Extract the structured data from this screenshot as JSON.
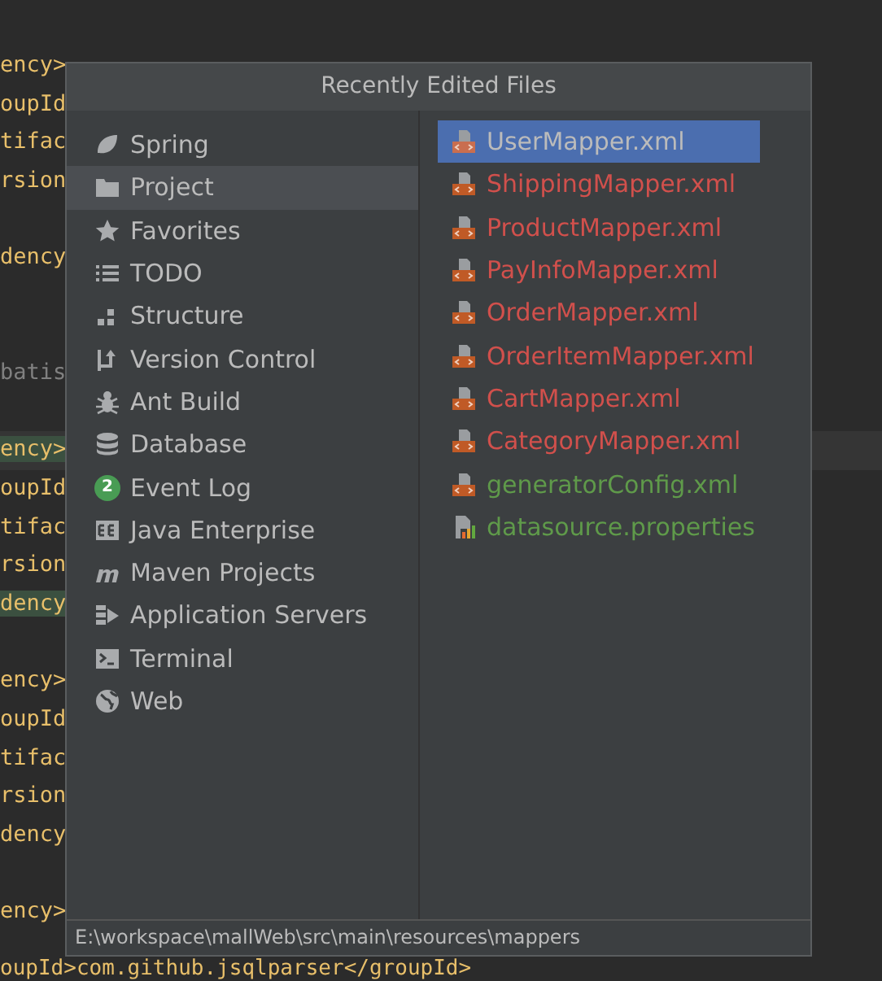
{
  "editor": {
    "lines": [
      {
        "text": "ency>",
        "kind": "tag",
        "highlight": false,
        "caret": false
      },
      {
        "text": "oupId",
        "kind": "tag",
        "highlight": false,
        "caret": false
      },
      {
        "text": "tifac",
        "kind": "tag",
        "highlight": false,
        "caret": false
      },
      {
        "text": "rsion",
        "kind": "tag",
        "highlight": false,
        "caret": false
      },
      {
        "kind": "blank"
      },
      {
        "text": "dency",
        "kind": "tag",
        "highlight": false,
        "caret": false
      },
      {
        "kind": "blank"
      },
      {
        "kind": "blank"
      },
      {
        "text": "batis",
        "kind": "comment",
        "highlight": false,
        "caret": false
      },
      {
        "kind": "blank"
      },
      {
        "text": "ency>",
        "kind": "tag",
        "highlight": true,
        "caret": true
      },
      {
        "text": "oupId",
        "kind": "tag",
        "highlight": false,
        "caret": false
      },
      {
        "text": "tifac",
        "kind": "tag",
        "highlight": false,
        "caret": false
      },
      {
        "text": "rsion",
        "kind": "tag",
        "highlight": false,
        "caret": false
      },
      {
        "text": "dency",
        "kind": "tag",
        "highlight": true,
        "caret": false
      },
      {
        "kind": "blank"
      },
      {
        "text": "ency>",
        "kind": "tag",
        "highlight": false,
        "caret": false
      },
      {
        "text": "oupId",
        "kind": "tag",
        "highlight": false,
        "caret": false
      },
      {
        "text": "tifac",
        "kind": "tag",
        "highlight": false,
        "caret": false
      },
      {
        "text": "rsion",
        "kind": "tag",
        "highlight": false,
        "caret": false
      },
      {
        "text": "dency",
        "kind": "tag",
        "highlight": false,
        "caret": false
      },
      {
        "kind": "blank"
      },
      {
        "text": "ency>",
        "kind": "tag",
        "highlight": false,
        "caret": false
      },
      {
        "text": "oupId>com.github.jsqlparser</groupId>",
        "kind": "tag",
        "highlight": false,
        "caret": false
      }
    ]
  },
  "popup": {
    "title": "Recently Edited Files",
    "tool_windows": [
      {
        "label": "Spring",
        "kind": "spring",
        "selected": false
      },
      {
        "label": "Project",
        "kind": "project",
        "selected": true
      },
      {
        "label": "Favorites",
        "kind": "favorites",
        "selected": false
      },
      {
        "label": "TODO",
        "kind": "todo",
        "selected": false
      },
      {
        "label": "Structure",
        "kind": "structure",
        "selected": false
      },
      {
        "label": "Version Control",
        "kind": "vcs",
        "selected": false
      },
      {
        "label": "Ant Build",
        "kind": "ant",
        "selected": false
      },
      {
        "label": "Database",
        "kind": "database",
        "selected": false
      },
      {
        "label": "Event Log",
        "kind": "badge",
        "badge": "2",
        "selected": false
      },
      {
        "label": "Java Enterprise",
        "kind": "ee",
        "selected": false
      },
      {
        "label": "Maven Projects",
        "kind": "maven",
        "selected": false
      },
      {
        "label": "Application Servers",
        "kind": "server",
        "selected": false
      },
      {
        "label": "Terminal",
        "kind": "terminal",
        "selected": false
      },
      {
        "label": "Web",
        "kind": "web",
        "selected": false
      }
    ],
    "files": [
      {
        "name": "UserMapper.xml",
        "kind": "xml",
        "color": "#bbbbbb",
        "selected": true
      },
      {
        "name": "ShippingMapper.xml",
        "kind": "xml",
        "color": "#d1504c",
        "selected": false
      },
      {
        "name": "ProductMapper.xml",
        "kind": "xml",
        "color": "#d1504c",
        "selected": false
      },
      {
        "name": "PayInfoMapper.xml",
        "kind": "xml",
        "color": "#d1504c",
        "selected": false
      },
      {
        "name": "OrderMapper.xml",
        "kind": "xml",
        "color": "#d1504c",
        "selected": false
      },
      {
        "name": "OrderItemMapper.xml",
        "kind": "xml",
        "color": "#d1504c",
        "selected": false
      },
      {
        "name": "CartMapper.xml",
        "kind": "xml",
        "color": "#d1504c",
        "selected": false
      },
      {
        "name": "CategoryMapper.xml",
        "kind": "xml",
        "color": "#d1504c",
        "selected": false
      },
      {
        "name": "generatorConfig.xml",
        "kind": "xml",
        "color": "#5f9a4a",
        "selected": false
      },
      {
        "name": "datasource.properties",
        "kind": "properties",
        "color": "#5f9a4a",
        "selected": false
      }
    ],
    "path": "E:\\workspace\\mallWeb\\src\\main\\resources\\mappers"
  }
}
